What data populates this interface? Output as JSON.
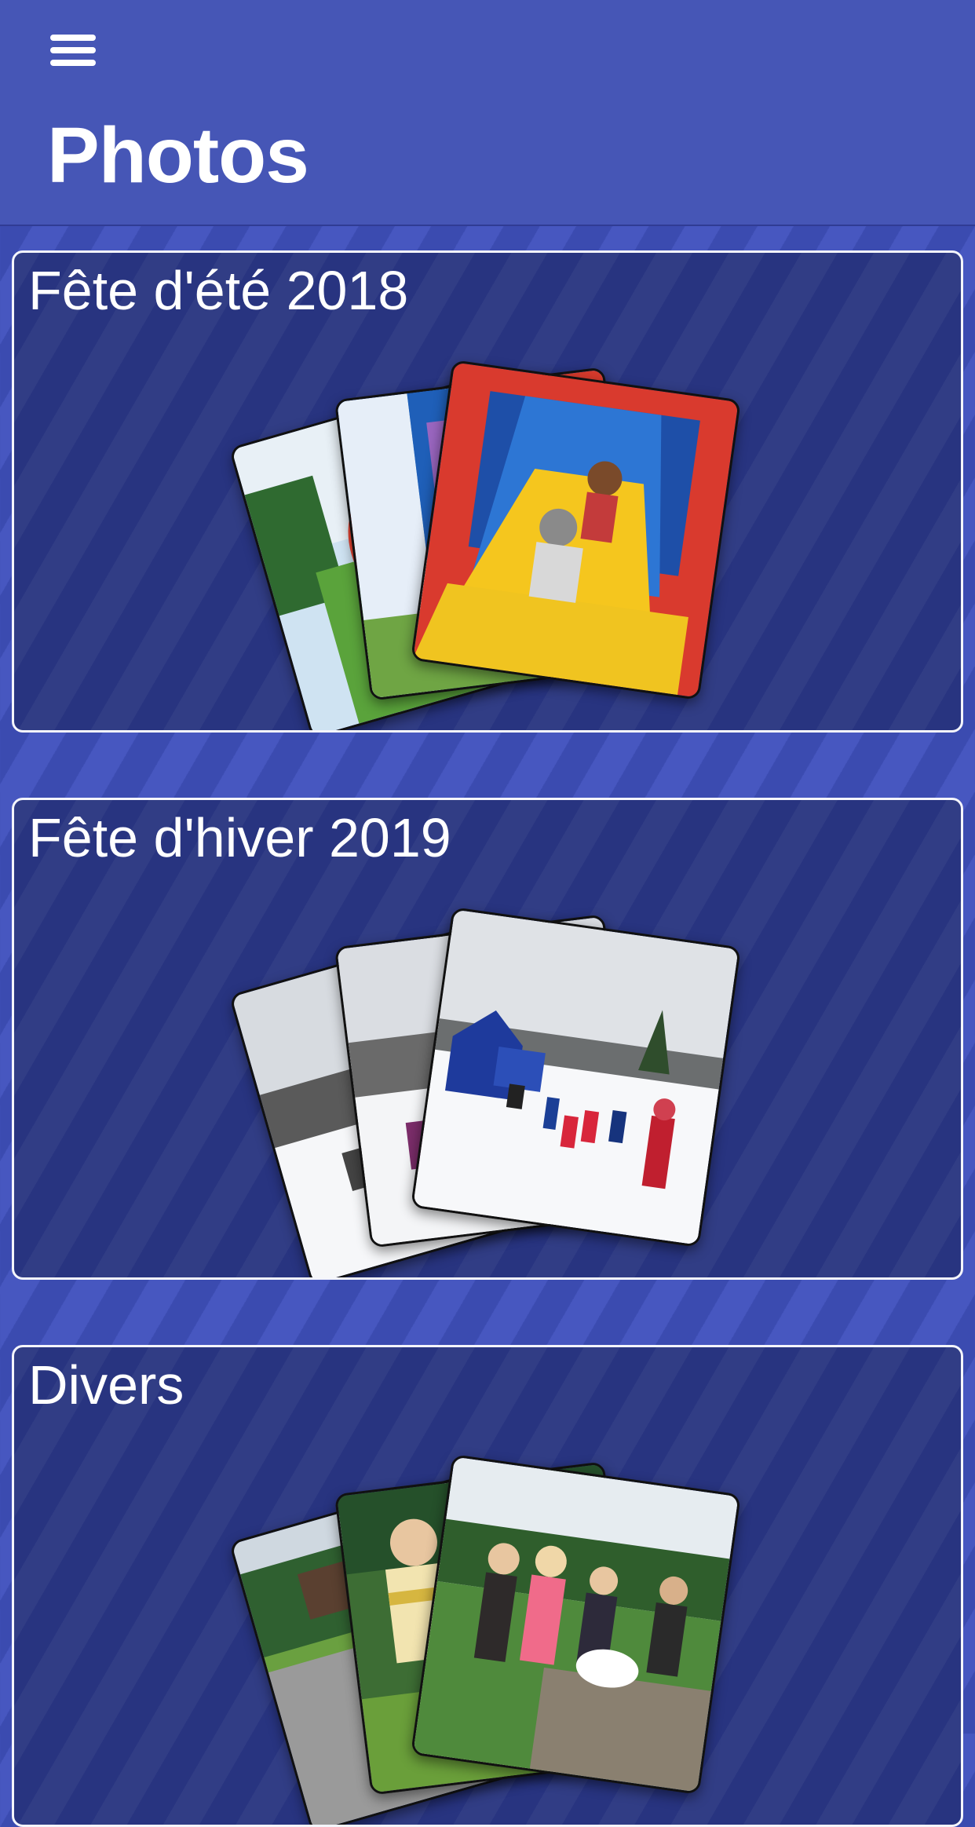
{
  "header": {
    "menu_icon": "hamburger-menu-icon",
    "title": "Photos"
  },
  "albums": [
    {
      "title": "Fête d'été 2018",
      "theme": "summer"
    },
    {
      "title": "Fête d'hiver 2019",
      "theme": "winter"
    },
    {
      "title": "Divers",
      "theme": "misc"
    }
  ]
}
